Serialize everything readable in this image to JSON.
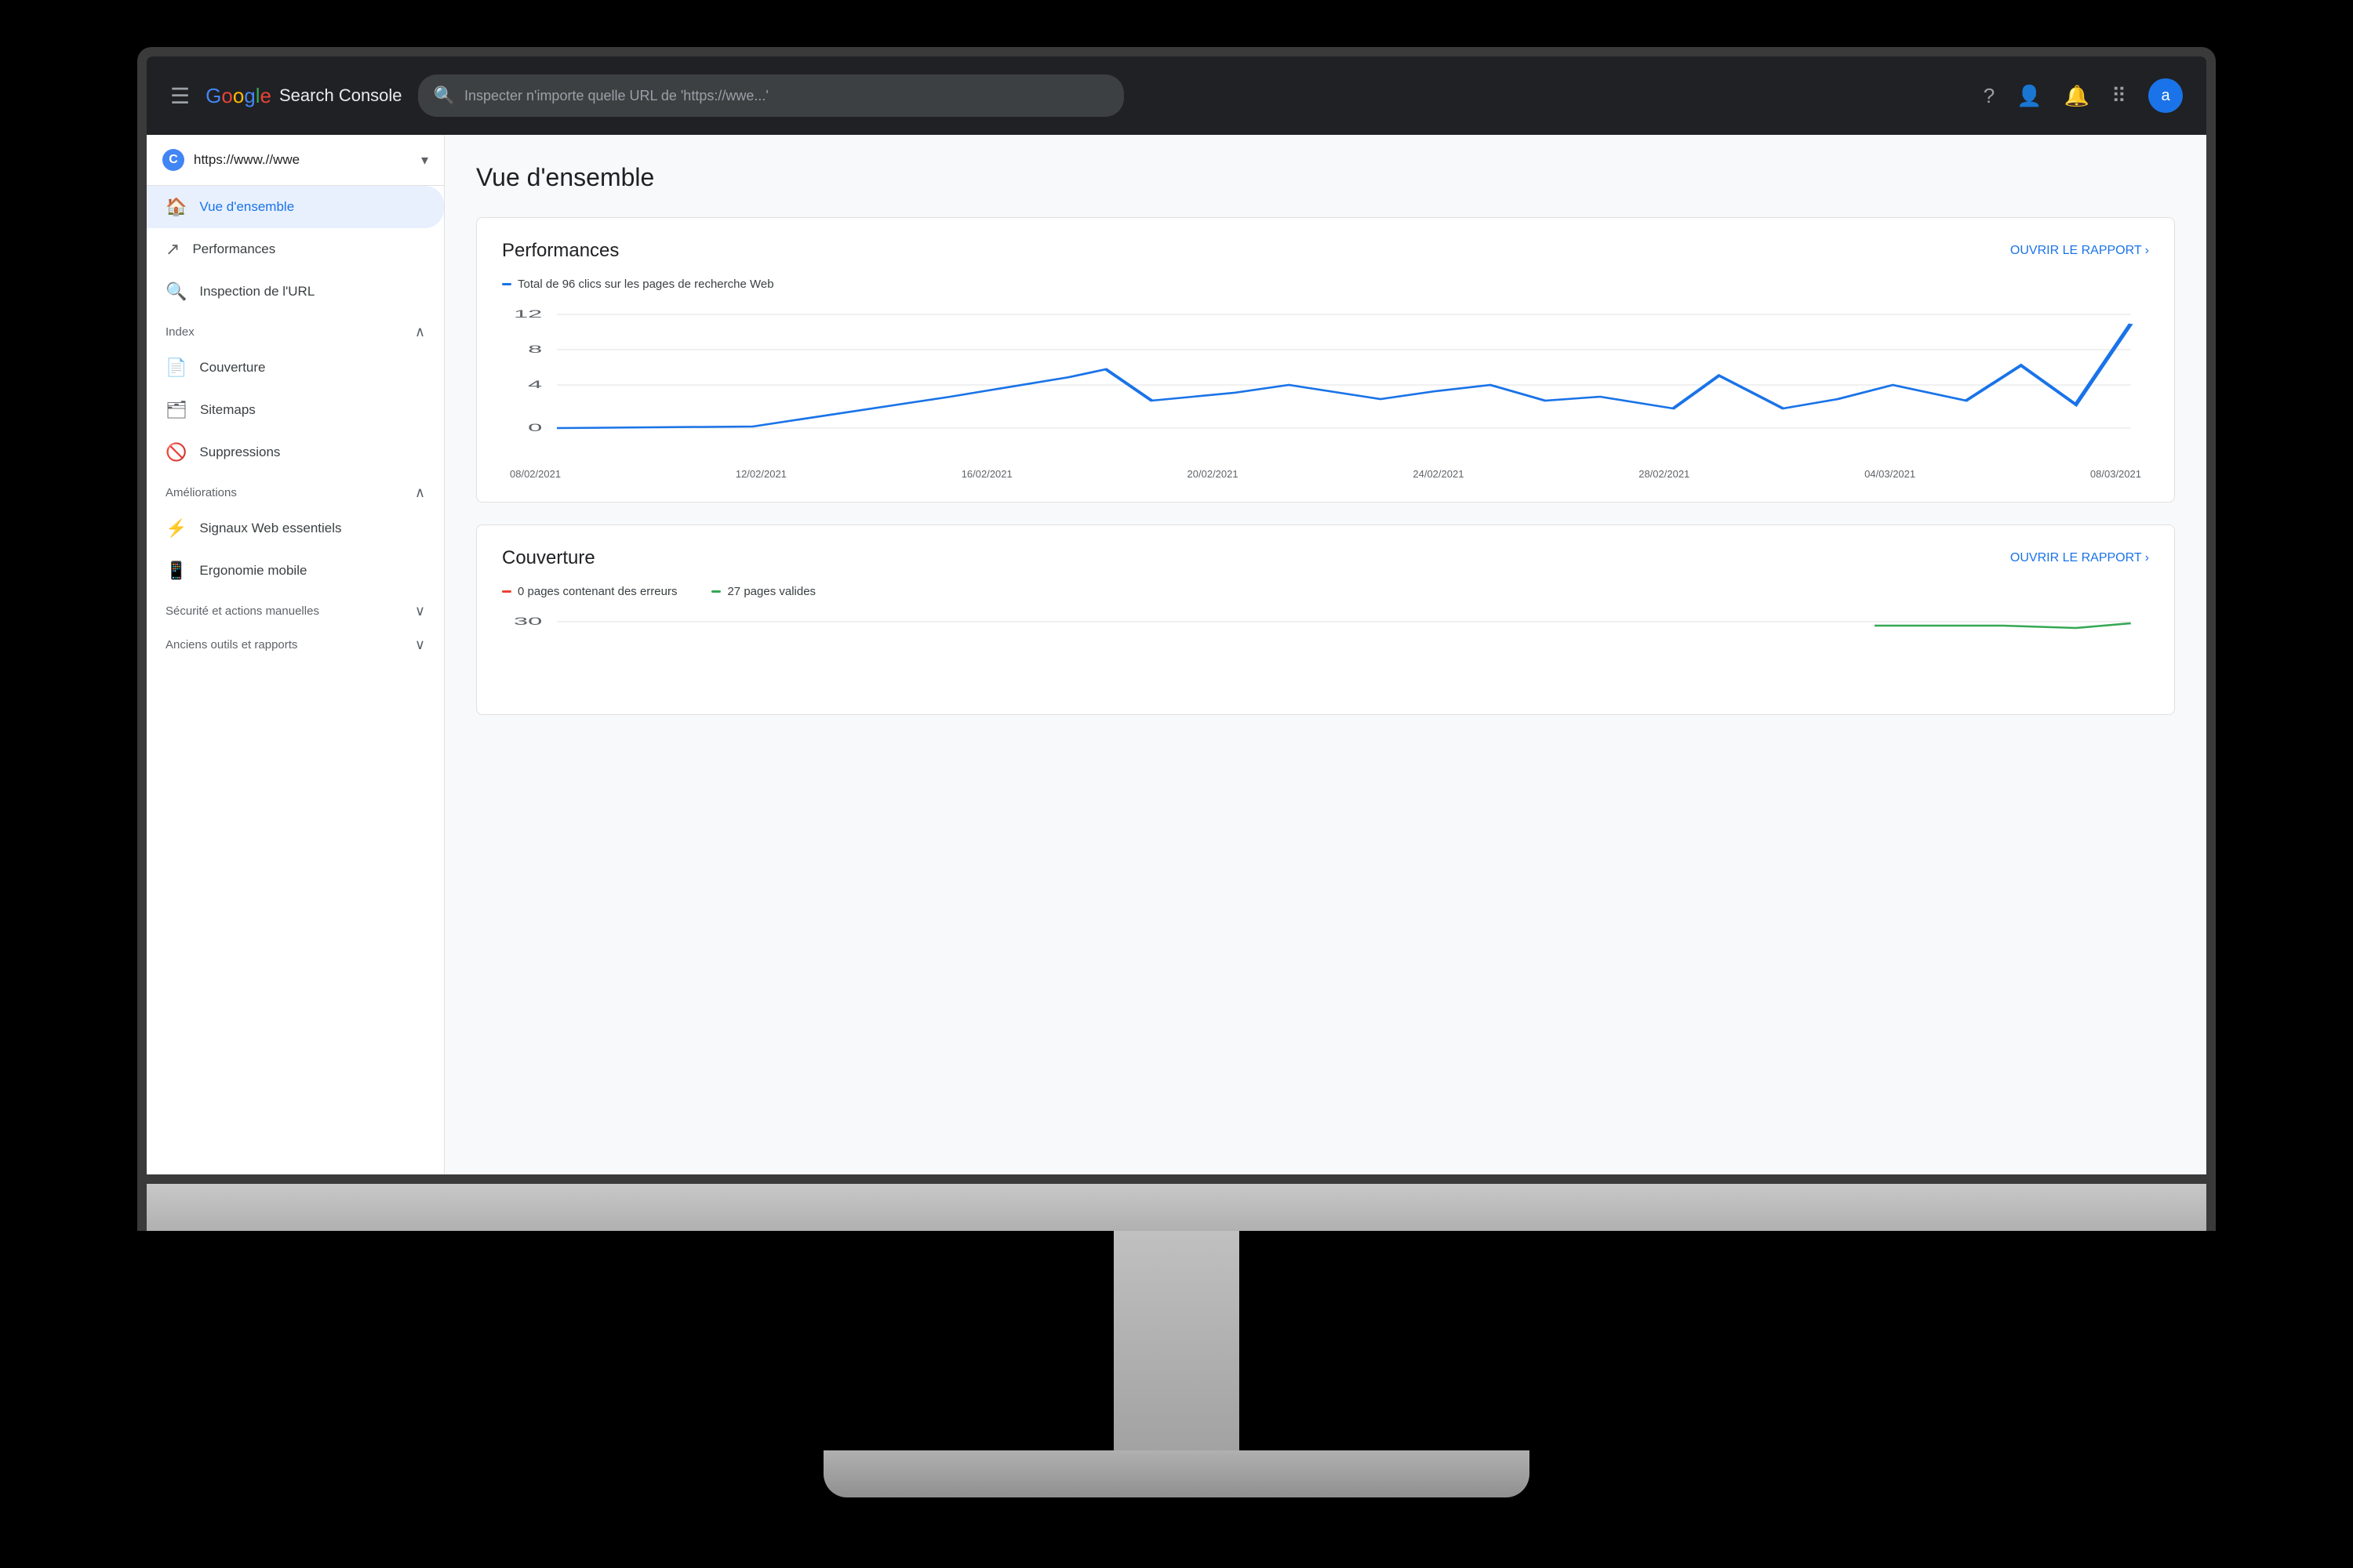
{
  "app": {
    "title": "Google Search Console",
    "logo_g": "G",
    "logo_search": "oogle",
    "logo_sc": "Search Console"
  },
  "topbar": {
    "search_placeholder": "Inspecter n'importe quelle URL de 'https://wwe...'",
    "avatar_label": "a"
  },
  "sidebar": {
    "property_url": "https://www.//wwe",
    "nav_items": [
      {
        "label": "Vue d'ensemble",
        "icon": "🏠",
        "active": true
      },
      {
        "label": "Performances",
        "icon": "↗"
      },
      {
        "label": "Inspection de l'URL",
        "icon": "🔍"
      }
    ],
    "sections": [
      {
        "title": "Index",
        "items": [
          {
            "label": "Couverture",
            "icon": "📄"
          },
          {
            "label": "Sitemaps",
            "icon": "🗂"
          },
          {
            "label": "Suppressions",
            "icon": "🚫"
          }
        ]
      },
      {
        "title": "Améliorations",
        "items": [
          {
            "label": "Signaux Web essentiels",
            "icon": "⚡"
          },
          {
            "label": "Ergonomie mobile",
            "icon": "📱"
          }
        ]
      },
      {
        "title": "Sécurité et actions manuelles",
        "collapsed": true
      },
      {
        "title": "Anciens outils et rapports",
        "collapsed": true
      }
    ]
  },
  "main": {
    "page_title": "Vue d'ensemble",
    "performances_card": {
      "title": "Performances",
      "link": "OUVRIR LE RAPPORT",
      "legend": "Total de 96 clics sur les pages de recherche Web",
      "y_labels": [
        "12",
        "8",
        "4",
        "0"
      ],
      "x_labels": [
        "08/02/2021",
        "12/02/2021",
        "16/02/2021",
        "20/02/2021",
        "24/02/2021",
        "28/02/2021",
        "04/03/2021",
        "08/03/2021"
      ]
    },
    "couverture_card": {
      "title": "Couverture",
      "link": "OUVRIR LE RAPPORT",
      "legend_errors": "0 pages contenant des erreurs",
      "legend_valid": "27 pages valides",
      "y_labels": [
        "30"
      ]
    }
  },
  "colors": {
    "blue": "#1a73e8",
    "red": "#ea4335",
    "green": "#34a853",
    "text_primary": "#202124",
    "text_secondary": "#5f6368"
  }
}
